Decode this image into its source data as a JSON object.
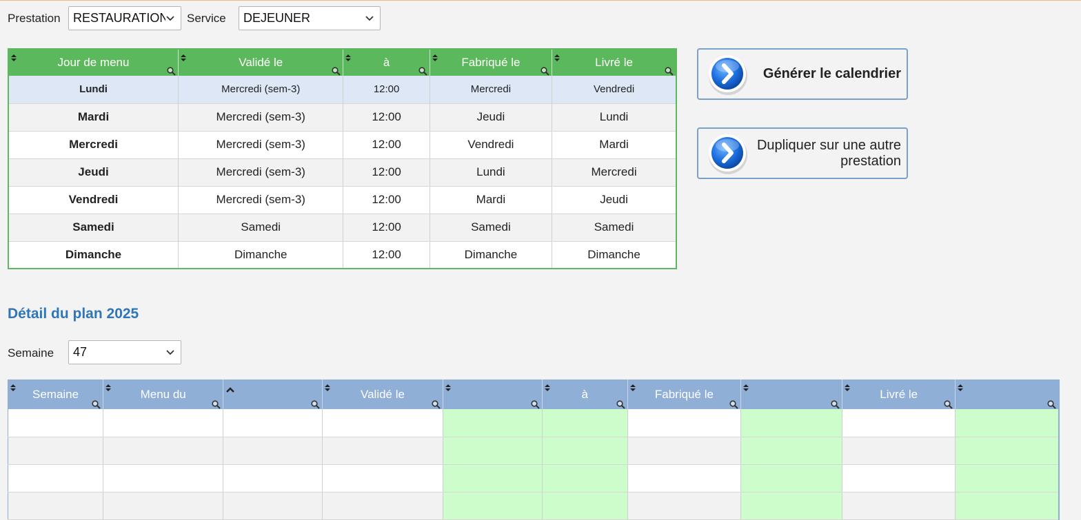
{
  "filters": {
    "prestation_label": "Prestation",
    "prestation_value": "RESTAURATION",
    "service_label": "Service",
    "service_value": "DEJEUNER"
  },
  "menu_table": {
    "headers": [
      "Jour de menu",
      "Validé le",
      "à",
      "Fabriqué le",
      "Livré le"
    ],
    "rows": [
      [
        "Lundi",
        "Mercredi (sem-3)",
        "12:00",
        "Mercredi",
        "Vendredi"
      ],
      [
        "Mardi",
        "Mercredi (sem-3)",
        "12:00",
        "Jeudi",
        "Lundi"
      ],
      [
        "Mercredi",
        "Mercredi (sem-3)",
        "12:00",
        "Vendredi",
        "Mardi"
      ],
      [
        "Jeudi",
        "Mercredi (sem-3)",
        "12:00",
        "Lundi",
        "Mercredi"
      ],
      [
        "Vendredi",
        "Mercredi (sem-3)",
        "12:00",
        "Mardi",
        "Jeudi"
      ],
      [
        "Samedi",
        "Samedi",
        "12:00",
        "Samedi",
        "Samedi"
      ],
      [
        "Dimanche",
        "Dimanche",
        "12:00",
        "Dimanche",
        "Dimanche"
      ]
    ]
  },
  "actions": {
    "generate_label": "Générer le calendrier",
    "duplicate_label": "Dupliquer sur une autre prestation"
  },
  "detail": {
    "title": "Détail du plan 2025",
    "week_label": "Semaine",
    "week_value": "47",
    "headers": [
      "Semaine",
      "Menu du",
      "",
      "Validé le",
      "",
      "à",
      "Fabriqué le",
      "",
      "Livré le",
      ""
    ]
  },
  "colors": {
    "menu_header": "#5cb85c",
    "detail_header": "#8fafd6",
    "highlight_cells": "#ccfdca",
    "selected_row": "#dde7f5",
    "title": "#2f76b7"
  }
}
